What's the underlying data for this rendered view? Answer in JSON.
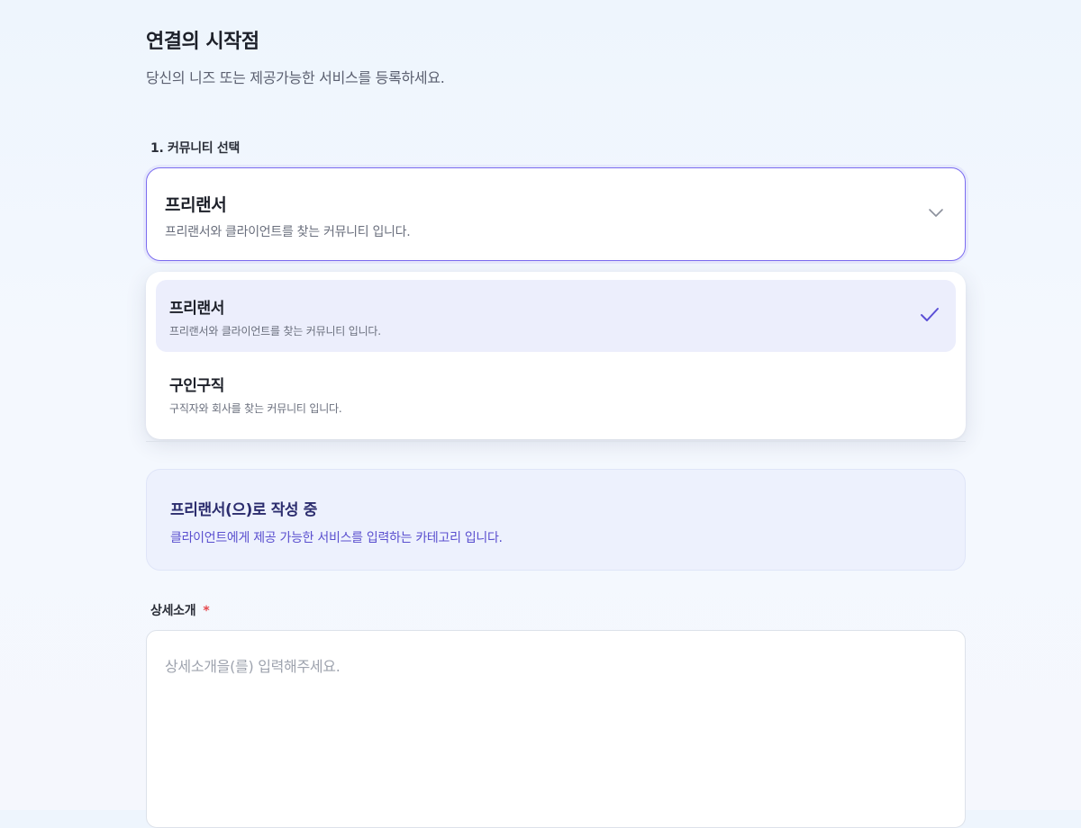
{
  "header": {
    "title": "연결의 시작점",
    "subtitle": "당신의 니즈 또는 제공가능한 서비스를 등록하세요."
  },
  "community": {
    "label": "1. 커뮤니티 선택",
    "selected": {
      "title": "프리랜서",
      "description": "프리랜서와 클라이언트를 찾는 커뮤니티 입니다."
    },
    "options": [
      {
        "title": "프리랜서",
        "description": "프리랜서와 클라이언트를 찾는 커뮤니티 입니다.",
        "selected": true
      },
      {
        "title": "구인구직",
        "description": "구직자와 회사를 찾는 커뮤니티 입니다.",
        "selected": false
      }
    ]
  },
  "info": {
    "title": "프리랜서(으)로 작성 중",
    "description": "클라이언트에게 제공 가능한 서비스를 입력하는 카테고리 입니다."
  },
  "detail": {
    "label": "상세소개",
    "required_mark": "*",
    "placeholder": "상세소개을(를) 입력해주세요.",
    "value": ""
  },
  "icons": {
    "dropdown": "chevron-down-icon",
    "selected_option": "check-icon"
  },
  "colors": {
    "accent": "#7b6cf0",
    "info_text": "#5a4fcf",
    "required": "#e5484d"
  }
}
